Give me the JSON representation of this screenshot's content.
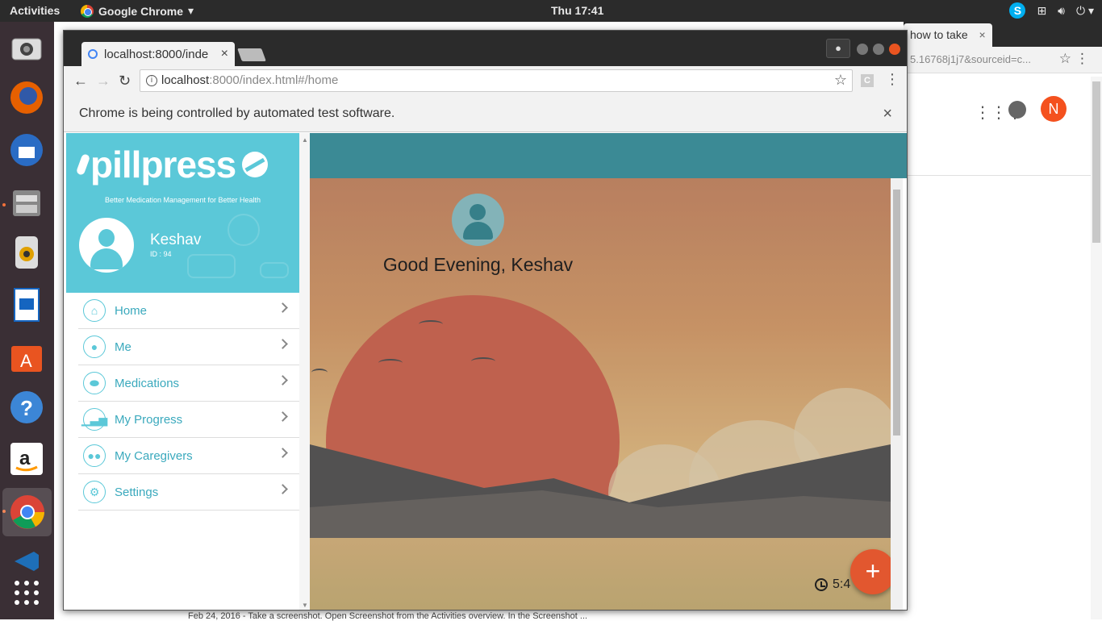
{
  "system": {
    "activities": "Activities",
    "app_menu": "Google Chrome",
    "clock": "Thu 17:41"
  },
  "background_window": {
    "tab_title": "how to take",
    "url_fragment": "5.16768j1j7&sourceid=c...",
    "avatar_letter": "N",
    "page_text": "Feb 24, 2016 - Take a screenshot. Open Screenshot from the Activities overview. In the Screenshot ..."
  },
  "browser": {
    "tab_title": "localhost:8000/inde",
    "url_host": "localhost",
    "url_path": ":8000/index.html#/home",
    "infobar_text": "Chrome is being controlled by automated test software.",
    "extension_label": "C"
  },
  "app": {
    "logo_text": "pillpress",
    "tagline": "Better Medication Management for Better Health",
    "user_name": "Keshav",
    "user_id": "ID : 94",
    "greeting": "Good Evening, Keshav",
    "time": "5:4",
    "fab_label": "+",
    "menu": [
      {
        "label": "Home",
        "icon": "home-icon"
      },
      {
        "label": "Me",
        "icon": "person-icon"
      },
      {
        "label": "Medications",
        "icon": "pill-icon"
      },
      {
        "label": "My Progress",
        "icon": "chart-icon"
      },
      {
        "label": "My Caregivers",
        "icon": "group-icon"
      },
      {
        "label": "Settings",
        "icon": "gear-icon"
      }
    ]
  },
  "colors": {
    "accent": "#5bc8d8",
    "appbar": "#3b8a95",
    "fab": "#e2572f"
  }
}
